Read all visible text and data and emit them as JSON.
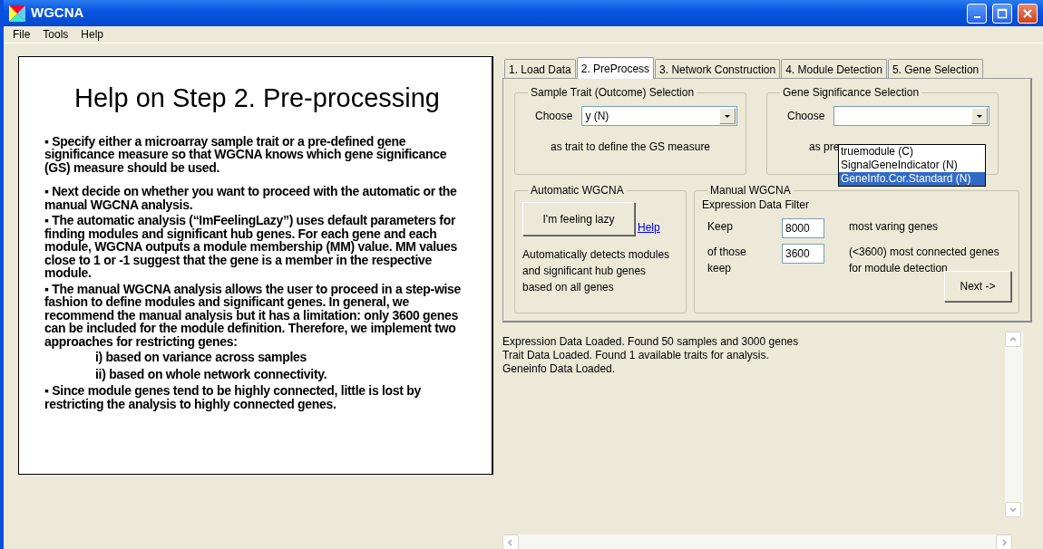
{
  "window": {
    "title": "WGCNA"
  },
  "menu": [
    "File",
    "Tools",
    "Help"
  ],
  "help": {
    "title": "Help on Step 2. Pre-processing",
    "paragraphs": [
      {
        "kind": "bullet",
        "text": "▪ Specify either a microarray sample trait or a pre-defined gene significance measure so that WGCNA knows which gene significance (GS) measure should be used."
      },
      {
        "kind": "bullet",
        "text": "▪ Next decide on whether you want to proceed with the automatic or the manual WGCNA analysis."
      },
      {
        "kind": "bullet",
        "text": "▪ The automatic analysis (“ImFeelingLazy”) uses default parameters for finding modules and significant hub genes. For each gene and each module, WGCNA outputs a module membership (MM) value. MM values close to 1 or -1 suggest that the gene is a member in the respective module."
      },
      {
        "kind": "bullet",
        "text": "▪ The manual WGCNA analysis allows the user to proceed in a step-wise fashion to define modules and significant genes. In general, we recommend the manual analysis but it has a limitation: only 3600 genes can be included for the module definition. Therefore, we implement two approaches for restricting genes:"
      },
      {
        "kind": "item",
        "text": "i) based on variance across samples"
      },
      {
        "kind": "item",
        "text": "ii) based on whole network connectivity."
      },
      {
        "kind": "bullet",
        "text": "▪ Since module genes tend to be highly connected, little is lost by restricting the analysis to highly connected genes."
      }
    ]
  },
  "tabs": [
    {
      "label": "1. Load Data",
      "selected": false
    },
    {
      "label": "2. PreProcess",
      "selected": true
    },
    {
      "label": "3. Network Construction",
      "selected": false
    },
    {
      "label": "4. Module Detection",
      "selected": false
    },
    {
      "label": "5. Gene Selection",
      "selected": false
    }
  ],
  "trait_group": {
    "title": "Sample Trait (Outcome) Selection",
    "label": "Choose",
    "value": "y (N)",
    "note": "as trait to define the GS measure"
  },
  "gs_group": {
    "title": "Gene Significance Selection",
    "label": "Choose",
    "note": "as pre",
    "expanded": true,
    "options": [
      {
        "label": "truemodule (C)",
        "selected": false
      },
      {
        "label": "SignalGeneIndicator (N)",
        "selected": false
      },
      {
        "label": "GeneInfo.Cor.Standard (N)",
        "selected": true
      }
    ]
  },
  "auto_group": {
    "title": "Automatic WGCNA",
    "button": "I'm feeling lazy",
    "link": "Help",
    "description": "Automatically detects modules and significant hub genes based on all genes"
  },
  "manual_group": {
    "title": "Manual WGCNA",
    "subtitle": "Expression Data Filter",
    "rows": [
      {
        "label": "Keep",
        "value": "8000",
        "note": "most varing genes"
      },
      {
        "label": "of those keep",
        "value": "3600",
        "note": "(<3600) most connected genes for module detection"
      }
    ],
    "button": "Next ->"
  },
  "log": [
    "Expression Data Loaded. Found 50 samples and 3000 genes",
    "Trait Data Loaded. Found 1 available traits for analysis.",
    "Geneinfo Data Loaded."
  ]
}
